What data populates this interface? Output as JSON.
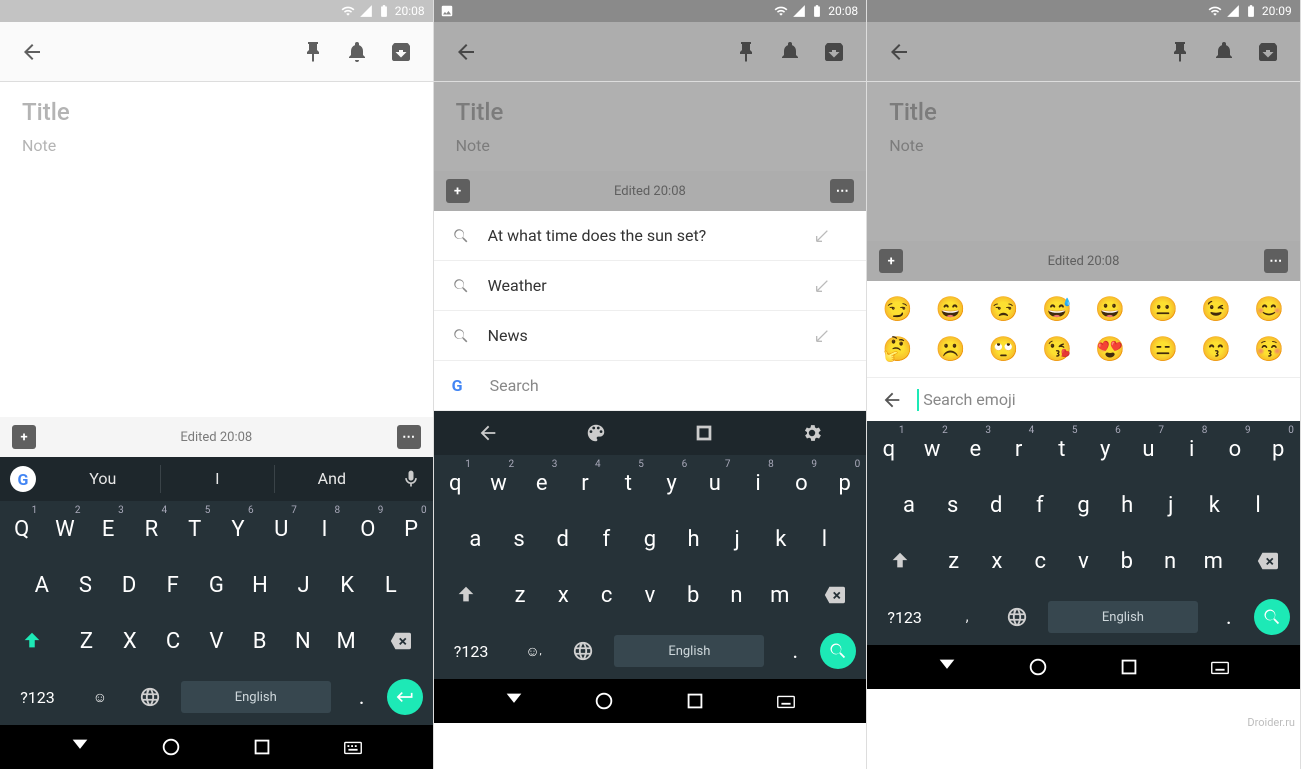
{
  "watermark": "Droider.ru",
  "phones": [
    {
      "time": "20:08",
      "title": "Title",
      "note": "Note",
      "edited": "Edited 20:08",
      "sugg": [
        "You",
        "I",
        "And"
      ],
      "space": "English",
      "sym": "?123",
      "row1": [
        "Q",
        "W",
        "E",
        "R",
        "T",
        "Y",
        "U",
        "I",
        "O",
        "P"
      ],
      "nums": [
        "1",
        "2",
        "3",
        "4",
        "5",
        "6",
        "7",
        "8",
        "9",
        "0"
      ],
      "row2": [
        "A",
        "S",
        "D",
        "F",
        "G",
        "H",
        "J",
        "K",
        "L"
      ],
      "row3": [
        "Z",
        "X",
        "C",
        "V",
        "B",
        "N",
        "M"
      ]
    },
    {
      "time": "20:08",
      "title": "Title",
      "note": "Note",
      "edited": "Edited 20:08",
      "search": [
        {
          "text": "At what time does the sun set?"
        },
        {
          "text": "Weather"
        },
        {
          "text": "News"
        }
      ],
      "searchph": "Search",
      "space": "English",
      "sym": "?123",
      "comma": ",",
      "row1": [
        "q",
        "w",
        "e",
        "r",
        "t",
        "y",
        "u",
        "i",
        "o",
        "p"
      ],
      "nums": [
        "1",
        "2",
        "3",
        "4",
        "5",
        "6",
        "7",
        "8",
        "9",
        "0"
      ],
      "row2": [
        "a",
        "s",
        "d",
        "f",
        "g",
        "h",
        "j",
        "k",
        "l"
      ],
      "row3": [
        "z",
        "x",
        "c",
        "v",
        "b",
        "n",
        "m"
      ]
    },
    {
      "time": "20:09",
      "title": "Title",
      "note": "Note",
      "edited": "Edited 20:08",
      "emojisearch": "Search emoji",
      "emoji_row1": [
        "😏",
        "😄",
        "😒",
        "😅",
        "😀",
        "😐",
        "😉",
        "😊"
      ],
      "emoji_row2": [
        "🤔",
        "☹️",
        "🙄",
        "😘",
        "😍",
        "😑",
        "😙",
        "😚"
      ],
      "space": "English",
      "sym": "?123",
      "comma": ",",
      "row1": [
        "q",
        "w",
        "e",
        "r",
        "t",
        "y",
        "u",
        "i",
        "o",
        "p"
      ],
      "nums": [
        "1",
        "2",
        "3",
        "4",
        "5",
        "6",
        "7",
        "8",
        "9",
        "0"
      ],
      "row2": [
        "a",
        "s",
        "d",
        "f",
        "g",
        "h",
        "j",
        "k",
        "l"
      ],
      "row3": [
        "z",
        "x",
        "c",
        "v",
        "b",
        "n",
        "m"
      ]
    }
  ]
}
